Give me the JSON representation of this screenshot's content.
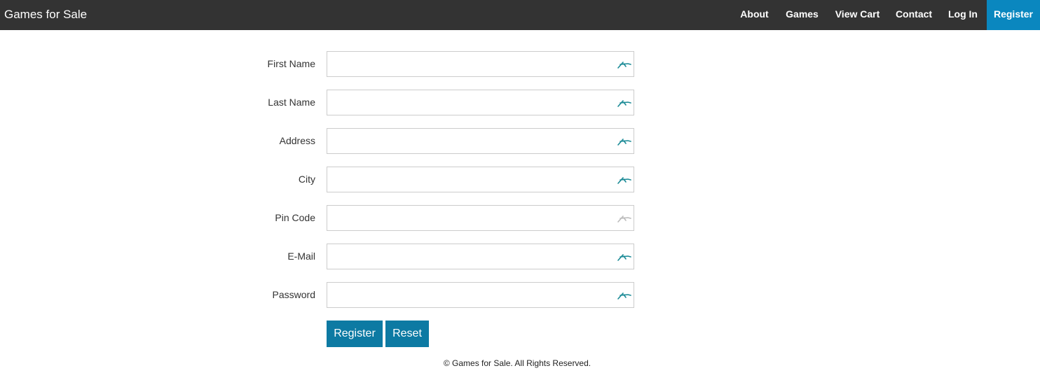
{
  "header": {
    "brand": "Games for Sale",
    "nav": [
      {
        "label": "About"
      },
      {
        "label": "Games"
      },
      {
        "label": "View Cart"
      },
      {
        "label": "Contact"
      },
      {
        "label": "Log In"
      },
      {
        "label": "Register",
        "active": true
      }
    ]
  },
  "form": {
    "fields": [
      {
        "label": "First Name",
        "value": "",
        "placeholder": ""
      },
      {
        "label": "Last Name",
        "value": "",
        "placeholder": ""
      },
      {
        "label": "Address",
        "value": "",
        "placeholder": ""
      },
      {
        "label": "City",
        "value": "",
        "placeholder": ""
      },
      {
        "label": "Pin Code",
        "value": "",
        "placeholder": ""
      },
      {
        "label": "E-Mail",
        "value": "",
        "placeholder": ""
      },
      {
        "label": "Password",
        "value": "",
        "placeholder": ""
      }
    ],
    "register_label": "Register",
    "reset_label": "Reset"
  },
  "footer": {
    "text": "© Games for Sale. All Rights Reserved."
  },
  "icons": {
    "field_icon": "autofill-icon"
  },
  "colors": {
    "navbar_bg": "#333333",
    "nav_active_bg": "#0a87bf",
    "button_bg": "#0d7aa3",
    "icon_active": "#1a8a96",
    "icon_inactive": "#bbbbbb"
  }
}
